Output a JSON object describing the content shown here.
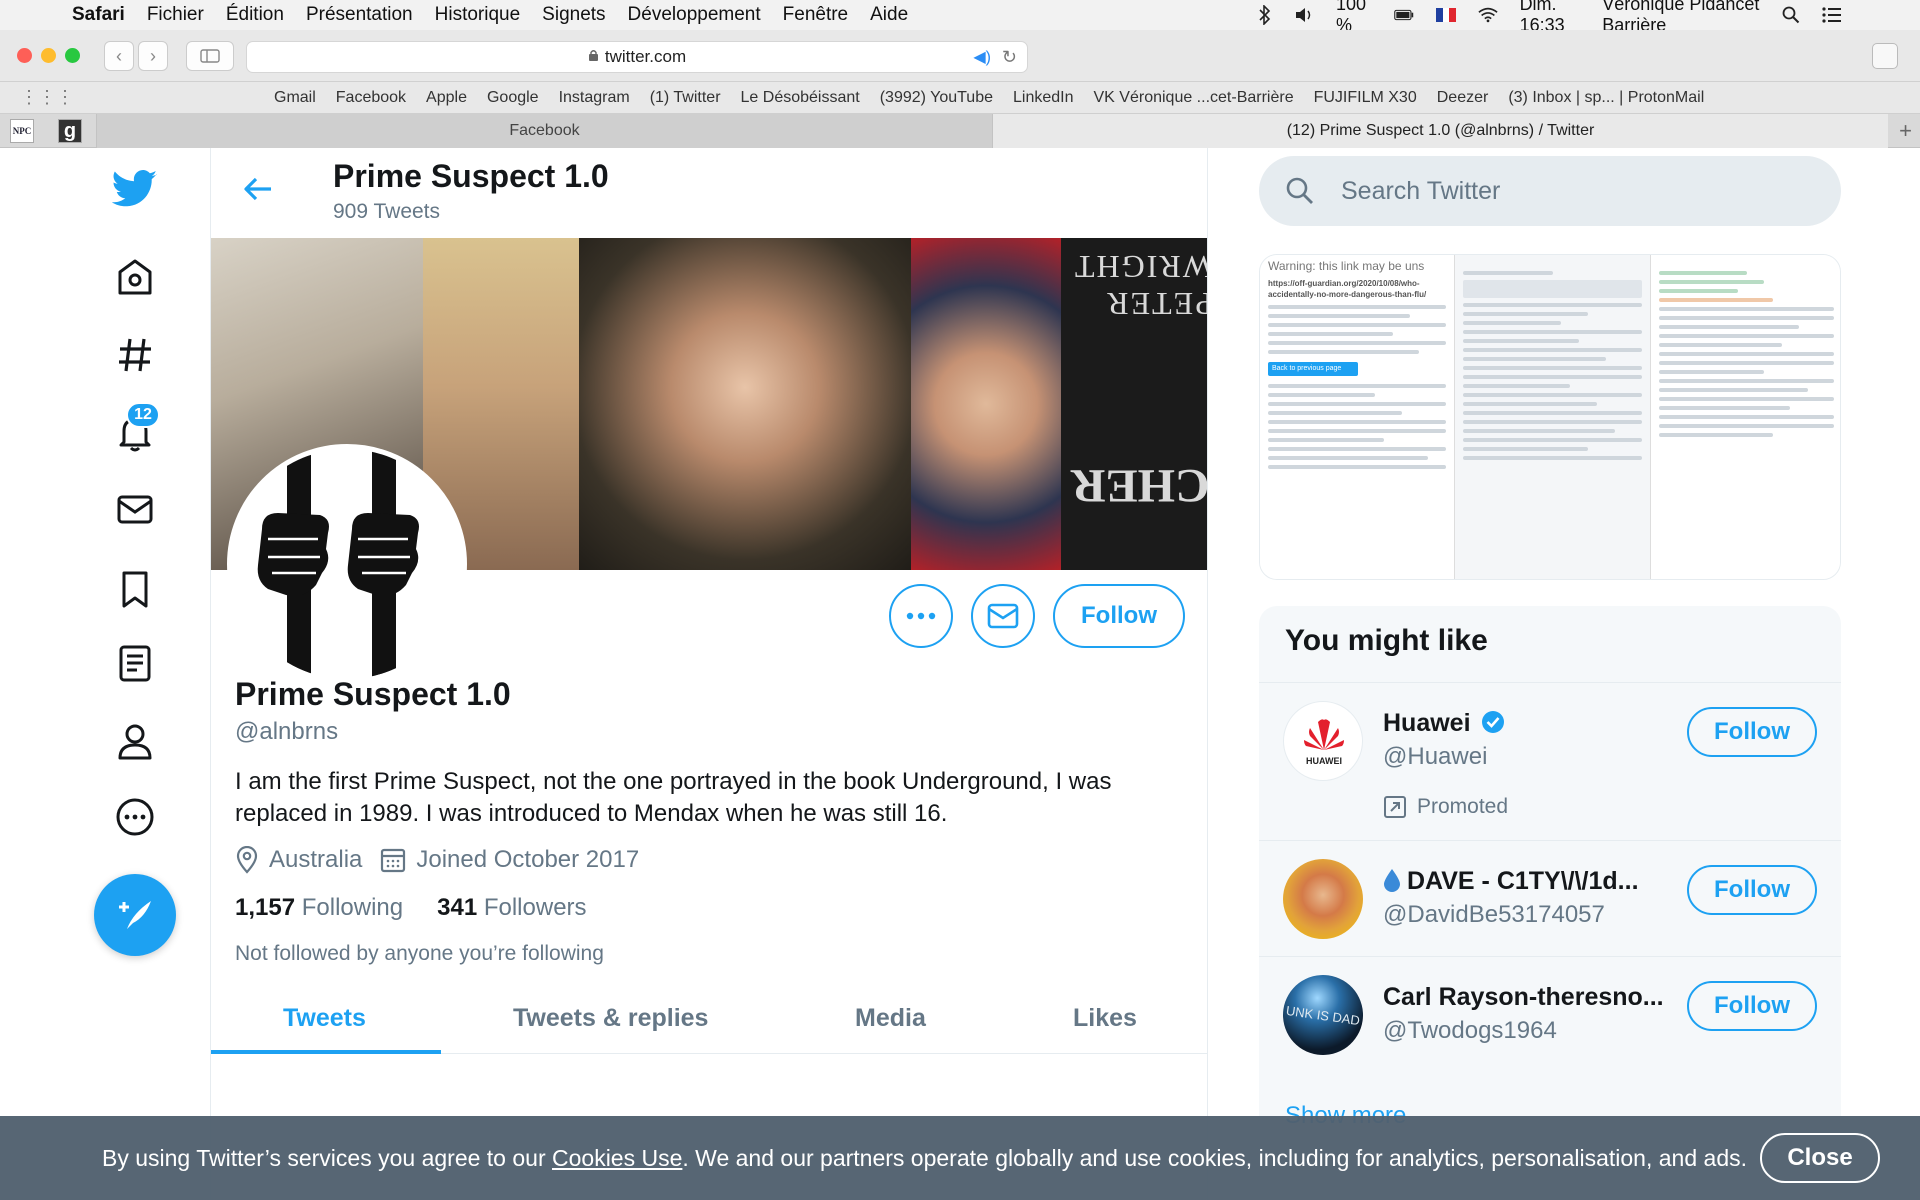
{
  "menubar": {
    "app_name": "Safari",
    "items": [
      "Fichier",
      "Édition",
      "Présentation",
      "Historique",
      "Signets",
      "Développement",
      "Fenêtre",
      "Aide"
    ],
    "battery": "100 %",
    "datetime": "Dim. 16:33",
    "user": "Véronique Pidancet Barrière"
  },
  "browser": {
    "url": "twitter.com",
    "bookmarks": [
      "Gmail",
      "Facebook",
      "Apple",
      "Google",
      "Instagram",
      "(1) Twitter",
      "Le Désobéissant",
      "(3992) YouTube",
      "LinkedIn",
      "VK Véronique ...cet-Barrière",
      "FUJIFILM X30",
      "Deezer",
      "(3) Inbox | sp... | ProtonMail"
    ],
    "pinned": [
      "NPC",
      "g"
    ],
    "tabs": [
      "Facebook",
      "(12) Prime Suspect 1.0 (@alnbrns) / Twitter"
    ]
  },
  "nav": {
    "notifications_badge": "12"
  },
  "header": {
    "name": "Prime Suspect 1.0",
    "tweet_count": "909 Tweets"
  },
  "banner": {
    "book_text_1": "PETER WRIGHT",
    "book_text_2": "SPYCATCHER"
  },
  "profile": {
    "name": "Prime Suspect 1.0",
    "handle": "@alnbrns",
    "bio": "I am the first Prime Suspect, not the one portrayed in the book Underground, I was replaced in 1989. I was introduced to Mendax when he was still 16.",
    "location": "Australia",
    "joined": "Joined October 2017",
    "following_count": "1,157",
    "following_label": "Following",
    "followers_count": "341",
    "followers_label": "Followers",
    "not_followed": "Not followed by anyone you’re following",
    "follow_label": "Follow"
  },
  "profile_tabs": [
    "Tweets",
    "Tweets & replies",
    "Media",
    "Likes"
  ],
  "search": {
    "placeholder": "Search Twitter"
  },
  "media_card": {
    "warning": "Warning: this link may be uns",
    "link": "https://off-guardian.org/2020/10/08/who-accidentally-no-more-dangerous-than-flu/",
    "back_button": "Back to previous page"
  },
  "you_might_like": {
    "title": "You might like",
    "items": [
      {
        "name": "Huawei",
        "handle": "@Huawei",
        "promoted": "Promoted",
        "follow": "Follow"
      },
      {
        "name": "DAVE - C1TY\\/\\/1d...",
        "handle": "@DavidBe53174057",
        "follow": "Follow"
      },
      {
        "name": "Carl Rayson-theresno...",
        "handle": "@Twodogs1964",
        "follow": "Follow"
      }
    ],
    "show_more": "Show more",
    "avatar_text_huawei": "HUAWEI",
    "avatar_text_carl": "UNK IS DAD"
  },
  "cookie": {
    "text_before": "By using Twitter’s services you agree to our ",
    "link": "Cookies Use",
    "text_after": ". We and our partners operate globally and use cookies, including for analytics, personalisation, and ads.",
    "close": "Close"
  },
  "colors": {
    "twitter_blue": "#1da1f2",
    "text_gray": "#657786",
    "cookie_bg": "#50606e"
  }
}
